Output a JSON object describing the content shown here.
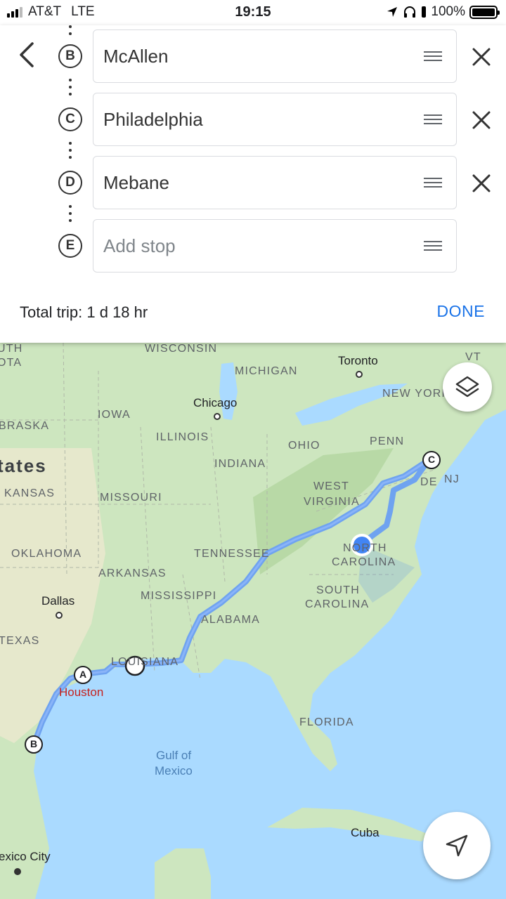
{
  "status_bar": {
    "carrier": "AT&T",
    "network": "LTE",
    "time": "19:15",
    "battery": "100%"
  },
  "stops": [
    {
      "letter": "B",
      "value": "McAllen",
      "placeholder": ""
    },
    {
      "letter": "C",
      "value": "Philadelphia",
      "placeholder": ""
    },
    {
      "letter": "D",
      "value": "Mebane",
      "placeholder": ""
    },
    {
      "letter": "E",
      "value": "",
      "placeholder": "Add stop"
    }
  ],
  "trip": {
    "total": "Total trip: 1 d 18 hr",
    "done_label": "DONE"
  },
  "map": {
    "labels": {
      "wisconsin": "WISCONSIN",
      "michigan": "MICHIGAN",
      "toronto": "Toronto",
      "vt": "VT",
      "new_york": "NEW YORK",
      "iowa": "IOWA",
      "chicago": "Chicago",
      "braska": "BRASKA",
      "illinois": "ILLINOIS",
      "ohio": "OHIO",
      "penn": "PENN",
      "indiana": "INDIANA",
      "tates": "tates",
      "kansas": "KANSAS",
      "missouri": "MISSOURI",
      "west_virginia_1": "WEST",
      "west_virginia_2": "VIRGINIA",
      "de": "DE",
      "nj": "NJ",
      "oklahoma": "OKLAHOMA",
      "tennessee": "TENNESSEE",
      "north_carolina_1": "NORTH",
      "north_carolina_2": "CAROLINA",
      "arkansas": "ARKANSAS",
      "mississippi": "MISSISSIPPI",
      "dallas": "Dallas",
      "south_carolina_1": "SOUTH",
      "south_carolina_2": "CAROLINA",
      "alabama": "ALABAMA",
      "texas": "TEXAS",
      "louisiana": "LOUISIANA",
      "houston": "Houston",
      "florida": "FLORIDA",
      "gulf_1": "Gulf of",
      "gulf_2": "Mexico",
      "cuba": "Cuba",
      "mexico_city": "exico City",
      "uth": "UTH",
      "ota": "OTA"
    },
    "markers": {
      "a": "A",
      "b": "B",
      "c": "C"
    },
    "colors": {
      "water": "#aadaff",
      "land": "#cde6bf",
      "route": "#6fa3f0",
      "current_location": "#4285f4"
    }
  }
}
